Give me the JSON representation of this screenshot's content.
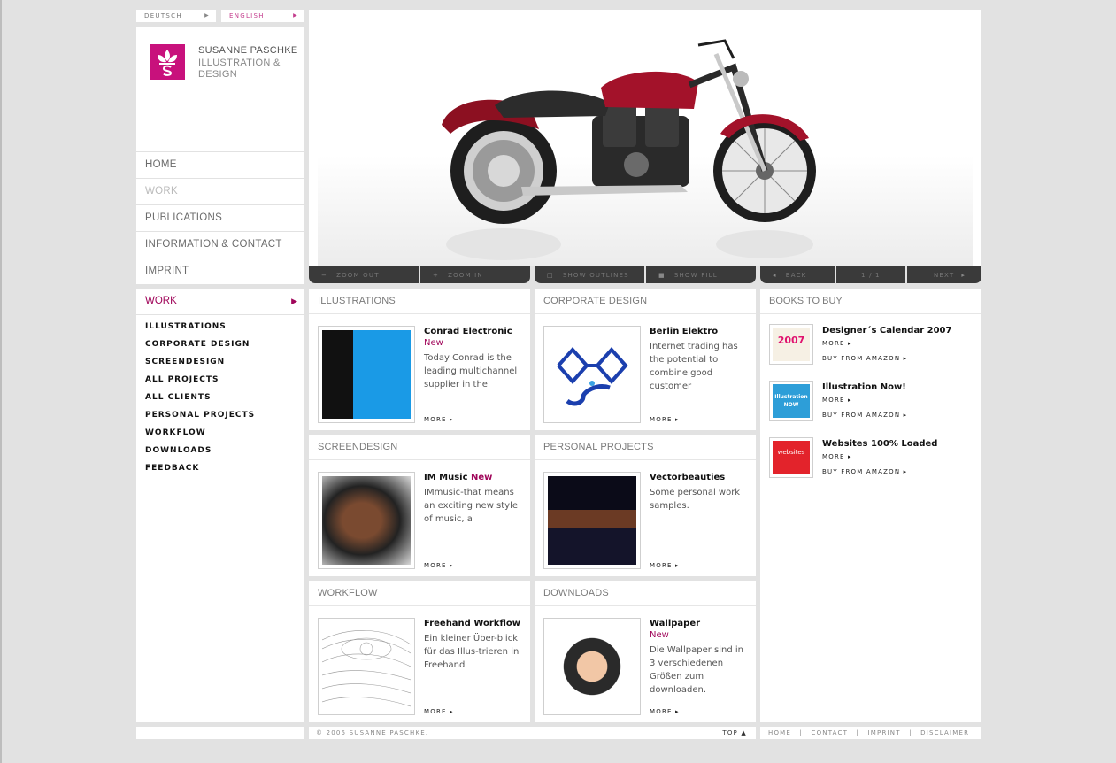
{
  "lang": {
    "deutsch": "DEUTSCH",
    "english": "ENGLISH",
    "arrow": "▶"
  },
  "brand": {
    "name_line1": "SUSANNE PASCHKE",
    "name_line2": "ILLUSTRATION &",
    "name_line3": "DESIGN"
  },
  "mainnav": [
    "HOME",
    "WORK",
    "PUBLICATIONS",
    "INFORMATION & CONTACT",
    "IMPRINT"
  ],
  "toolbar": {
    "zoom_out": "ZOOM OUT",
    "zoom_in": "ZOOM IN",
    "show_outlines": "SHOW OUTLINES",
    "show_fill": "SHOW FILL",
    "back": "BACK",
    "pager": "1 / 1",
    "next": "NEXT"
  },
  "subnav": {
    "head": "WORK",
    "items": [
      "ILLUSTRATIONS",
      "CORPORATE DESIGN",
      "SCREENDESIGN",
      "ALL PROJECTS",
      "ALL CLIENTS",
      "PERSONAL PROJECTS",
      "WORKFLOW",
      "DOWNLOADS",
      "FEEDBACK"
    ]
  },
  "cards": [
    {
      "section": "ILLUSTRATIONS",
      "title": "Conrad Electronic",
      "badge": "New",
      "text": "Today Conrad is the leading multichannel supplier in the",
      "more": "MORE ▸"
    },
    {
      "section": "CORPORATE DESIGN",
      "title": "Berlin Elektro",
      "badge": "",
      "text": "Internet trading has the potential to combine good customer",
      "more": "MORE ▸"
    },
    {
      "section": "SCREENDESIGN",
      "title": "IM Music",
      "badge": "New",
      "text": "IMmusic-that means an exciting new style of music, a",
      "more": "MORE ▸"
    },
    {
      "section": "PERSONAL PROJECTS",
      "title": "Vectorbeauties",
      "badge": "",
      "text": "Some personal work samples.",
      "more": "MORE ▸"
    },
    {
      "section": "WORKFLOW",
      "title": "Freehand Workflow",
      "badge": "",
      "text": "Ein kleiner Über-blick für das Illus-trieren in Freehand",
      "more": "MORE ▸"
    },
    {
      "section": "DOWNLOADS",
      "title": "Wallpaper",
      "badge": "New",
      "text": "Die Wallpaper sind in 3 verschiedenen Größen zum downloaden.",
      "more": "MORE ▸"
    }
  ],
  "books": {
    "title": "BOOKS TO BUY",
    "items": [
      {
        "title": "Designer´s Calendar 2007",
        "more": "MORE ▸",
        "buy": "BUY FROM AMAZON ▸",
        "cover_text": "2007"
      },
      {
        "title": "Illustration Now!",
        "more": "MORE ▸",
        "buy": "BUY FROM AMAZON ▸",
        "cover_text": "Illustration NOW"
      },
      {
        "title": "Websites 100% Loaded",
        "more": "MORE ▸",
        "buy": "BUY FROM AMAZON ▸",
        "cover_text": "websites"
      }
    ]
  },
  "footer": {
    "copyright": "© 2005 SUSANNE PASCHKE.",
    "top": "TOP ▲",
    "links": [
      "HOME",
      "CONTACT",
      "IMPRINT",
      "DISCLAIMER"
    ],
    "sep": "|"
  },
  "colors": {
    "accent": "#a0065a",
    "logo": "#c8117c",
    "bg": "#e2e2e2",
    "toolbar": "#3a3a3a"
  }
}
